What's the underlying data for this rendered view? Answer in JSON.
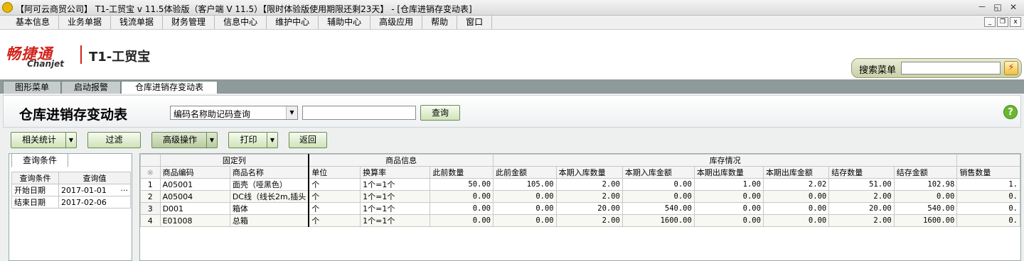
{
  "titlebar": {
    "title": "【阿可云商贸公司】 T1-工贸宝 v 11.5体验版（客户端 V 11.5）【限时体验版使用期限还剩23天】 - [仓库进销存变动表]",
    "btn_min": "－",
    "btn_restore": "◱",
    "btn_close": "✕"
  },
  "menubar": {
    "items": [
      "基本信息",
      "业务单据",
      "钱流单据",
      "财务管理",
      "信息中心",
      "维护中心",
      "辅助中心",
      "高级应用",
      "帮助",
      "窗口"
    ],
    "mdi_min": "_",
    "mdi_restore": "❐",
    "mdi_close": "x"
  },
  "brand": {
    "logo_cn": "畅捷通",
    "logo_en": "Chanjet",
    "product": "T1-工贸宝"
  },
  "search": {
    "label": "搜索菜单",
    "value": "",
    "go_icon": "⚡"
  },
  "tabs": [
    "图形菜单",
    "启动报警",
    "仓库进销存变动表"
  ],
  "header": {
    "page_title": "仓库进销存变动表",
    "search_mode": "编码名称助记码查询",
    "query_value": "",
    "query_button": "查询",
    "help_icon": "?"
  },
  "toolbar": {
    "stats": "相关统计",
    "filter": "过滤",
    "advanced": "高级操作",
    "print": "打印",
    "back": "返回",
    "dropdown_icon": "▼"
  },
  "left_pane": {
    "tab_label": "查询条件",
    "col_condition": "查询条件",
    "col_value": "查询值",
    "rows": [
      {
        "label": "开始日期",
        "value": "2017-01-01",
        "ellipsis": "···"
      },
      {
        "label": "结束日期",
        "value": "2017-02-06",
        "ellipsis": ""
      }
    ]
  },
  "grid": {
    "groups": {
      "fixed": "固定列",
      "goods": "商品信息",
      "stock": "库存情况"
    },
    "corner": "※",
    "columns": [
      "商品编码",
      "商品名称",
      "单位",
      "换算率",
      "此前数量",
      "此前金额",
      "本期入库数量",
      "本期入库金额",
      "本期出库数量",
      "本期出库金额",
      "结存数量",
      "结存金额",
      "销售数量"
    ],
    "rows": [
      {
        "idx": "1",
        "code": "A05001",
        "name": "面壳（哑黑色）",
        "unit": "个",
        "rate": "1个=1个",
        "prev_qty": "50.00",
        "prev_amt": "105.00",
        "in_qty": "2.00",
        "in_amt": "0.00",
        "out_qty": "1.00",
        "out_amt": "2.02",
        "bal_qty": "51.00",
        "bal_amt": "102.98",
        "sale_qty": "1."
      },
      {
        "idx": "2",
        "code": "A05004",
        "name": "DC线（线长2m,插头",
        "unit": "个",
        "rate": "1个=1个",
        "prev_qty": "0.00",
        "prev_amt": "0.00",
        "in_qty": "2.00",
        "in_amt": "0.00",
        "out_qty": "0.00",
        "out_amt": "0.00",
        "bal_qty": "2.00",
        "bal_amt": "0.00",
        "sale_qty": "0."
      },
      {
        "idx": "3",
        "code": "D001",
        "name": "箱体",
        "unit": "个",
        "rate": "1个=1个",
        "prev_qty": "0.00",
        "prev_amt": "0.00",
        "in_qty": "20.00",
        "in_amt": "540.00",
        "out_qty": "0.00",
        "out_amt": "0.00",
        "bal_qty": "20.00",
        "bal_amt": "540.00",
        "sale_qty": "0."
      },
      {
        "idx": "4",
        "code": "E01008",
        "name": "总箱",
        "unit": "个",
        "rate": "1个=1个",
        "prev_qty": "0.00",
        "prev_amt": "0.00",
        "in_qty": "2.00",
        "in_amt": "1600.00",
        "out_qty": "0.00",
        "out_amt": "0.00",
        "bal_qty": "2.00",
        "bal_amt": "1600.00",
        "sale_qty": "0."
      }
    ]
  }
}
